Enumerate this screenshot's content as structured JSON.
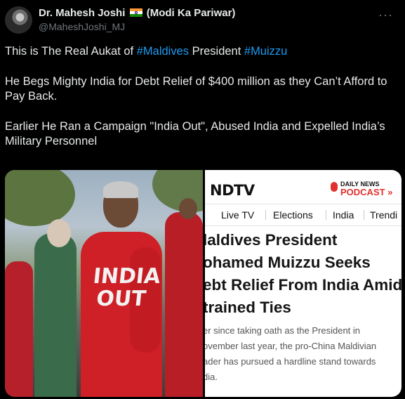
{
  "author": {
    "name": "Dr. Mahesh Joshi",
    "flag_icon": "india-flag-icon",
    "name_suffix": "(Modi Ka Pariwar)",
    "handle": "@MaheshJoshi_MJ"
  },
  "more_icon": "ellipsis-icon",
  "tweet": {
    "line1_pre": "This is The Real Aukat of ",
    "hashtag1": "#Maldives",
    "line1_mid": " President ",
    "hashtag2": "#Muizzu",
    "para2": "He Begs Mighty India for Debt Relief of $400 million as they Can’t Afford to Pay Back.",
    "para3": "Earlier He Ran a Campaign \"India Out\", Abused India and Expelled India’s Military Personnel"
  },
  "photo": {
    "shirt_line1": "INDIA",
    "shirt_line2": "OUT"
  },
  "ndtv": {
    "logo": "NDTV",
    "podcast_top": "DAILY NEWS",
    "podcast_bottom": "PODCAST »",
    "nav": [
      "Live TV",
      "Elections",
      "India",
      "Trendi"
    ],
    "headline": [
      "laldives President",
      "ohamed Muizzu Seeks",
      "ebt Relief From India Amid",
      "trained Ties"
    ],
    "article": [
      "er since taking oath as the President in",
      "ovember last year, the pro-China Maldivian",
      "ader has pursued a hardline stand towards",
      "dia."
    ]
  }
}
